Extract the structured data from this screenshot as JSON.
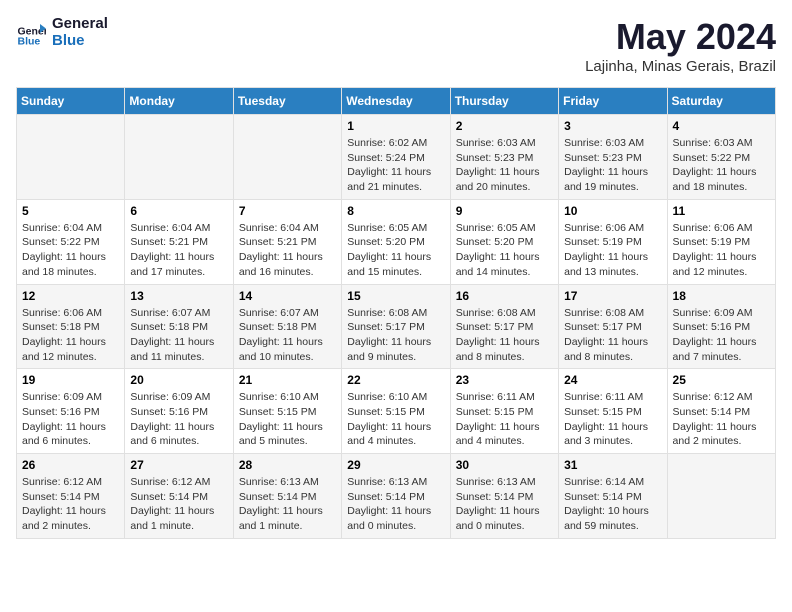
{
  "logo": {
    "line1": "General",
    "line2": "Blue"
  },
  "title": "May 2024",
  "location": "Lajinha, Minas Gerais, Brazil",
  "headers": [
    "Sunday",
    "Monday",
    "Tuesday",
    "Wednesday",
    "Thursday",
    "Friday",
    "Saturday"
  ],
  "weeks": [
    [
      {
        "day": "",
        "info": ""
      },
      {
        "day": "",
        "info": ""
      },
      {
        "day": "",
        "info": ""
      },
      {
        "day": "1",
        "info": "Sunrise: 6:02 AM\nSunset: 5:24 PM\nDaylight: 11 hours\nand 21 minutes."
      },
      {
        "day": "2",
        "info": "Sunrise: 6:03 AM\nSunset: 5:23 PM\nDaylight: 11 hours\nand 20 minutes."
      },
      {
        "day": "3",
        "info": "Sunrise: 6:03 AM\nSunset: 5:23 PM\nDaylight: 11 hours\nand 19 minutes."
      },
      {
        "day": "4",
        "info": "Sunrise: 6:03 AM\nSunset: 5:22 PM\nDaylight: 11 hours\nand 18 minutes."
      }
    ],
    [
      {
        "day": "5",
        "info": "Sunrise: 6:04 AM\nSunset: 5:22 PM\nDaylight: 11 hours\nand 18 minutes."
      },
      {
        "day": "6",
        "info": "Sunrise: 6:04 AM\nSunset: 5:21 PM\nDaylight: 11 hours\nand 17 minutes."
      },
      {
        "day": "7",
        "info": "Sunrise: 6:04 AM\nSunset: 5:21 PM\nDaylight: 11 hours\nand 16 minutes."
      },
      {
        "day": "8",
        "info": "Sunrise: 6:05 AM\nSunset: 5:20 PM\nDaylight: 11 hours\nand 15 minutes."
      },
      {
        "day": "9",
        "info": "Sunrise: 6:05 AM\nSunset: 5:20 PM\nDaylight: 11 hours\nand 14 minutes."
      },
      {
        "day": "10",
        "info": "Sunrise: 6:06 AM\nSunset: 5:19 PM\nDaylight: 11 hours\nand 13 minutes."
      },
      {
        "day": "11",
        "info": "Sunrise: 6:06 AM\nSunset: 5:19 PM\nDaylight: 11 hours\nand 12 minutes."
      }
    ],
    [
      {
        "day": "12",
        "info": "Sunrise: 6:06 AM\nSunset: 5:18 PM\nDaylight: 11 hours\nand 12 minutes."
      },
      {
        "day": "13",
        "info": "Sunrise: 6:07 AM\nSunset: 5:18 PM\nDaylight: 11 hours\nand 11 minutes."
      },
      {
        "day": "14",
        "info": "Sunrise: 6:07 AM\nSunset: 5:18 PM\nDaylight: 11 hours\nand 10 minutes."
      },
      {
        "day": "15",
        "info": "Sunrise: 6:08 AM\nSunset: 5:17 PM\nDaylight: 11 hours\nand 9 minutes."
      },
      {
        "day": "16",
        "info": "Sunrise: 6:08 AM\nSunset: 5:17 PM\nDaylight: 11 hours\nand 8 minutes."
      },
      {
        "day": "17",
        "info": "Sunrise: 6:08 AM\nSunset: 5:17 PM\nDaylight: 11 hours\nand 8 minutes."
      },
      {
        "day": "18",
        "info": "Sunrise: 6:09 AM\nSunset: 5:16 PM\nDaylight: 11 hours\nand 7 minutes."
      }
    ],
    [
      {
        "day": "19",
        "info": "Sunrise: 6:09 AM\nSunset: 5:16 PM\nDaylight: 11 hours\nand 6 minutes."
      },
      {
        "day": "20",
        "info": "Sunrise: 6:09 AM\nSunset: 5:16 PM\nDaylight: 11 hours\nand 6 minutes."
      },
      {
        "day": "21",
        "info": "Sunrise: 6:10 AM\nSunset: 5:15 PM\nDaylight: 11 hours\nand 5 minutes."
      },
      {
        "day": "22",
        "info": "Sunrise: 6:10 AM\nSunset: 5:15 PM\nDaylight: 11 hours\nand 4 minutes."
      },
      {
        "day": "23",
        "info": "Sunrise: 6:11 AM\nSunset: 5:15 PM\nDaylight: 11 hours\nand 4 minutes."
      },
      {
        "day": "24",
        "info": "Sunrise: 6:11 AM\nSunset: 5:15 PM\nDaylight: 11 hours\nand 3 minutes."
      },
      {
        "day": "25",
        "info": "Sunrise: 6:12 AM\nSunset: 5:14 PM\nDaylight: 11 hours\nand 2 minutes."
      }
    ],
    [
      {
        "day": "26",
        "info": "Sunrise: 6:12 AM\nSunset: 5:14 PM\nDaylight: 11 hours\nand 2 minutes."
      },
      {
        "day": "27",
        "info": "Sunrise: 6:12 AM\nSunset: 5:14 PM\nDaylight: 11 hours\nand 1 minute."
      },
      {
        "day": "28",
        "info": "Sunrise: 6:13 AM\nSunset: 5:14 PM\nDaylight: 11 hours\nand 1 minute."
      },
      {
        "day": "29",
        "info": "Sunrise: 6:13 AM\nSunset: 5:14 PM\nDaylight: 11 hours\nand 0 minutes."
      },
      {
        "day": "30",
        "info": "Sunrise: 6:13 AM\nSunset: 5:14 PM\nDaylight: 11 hours\nand 0 minutes."
      },
      {
        "day": "31",
        "info": "Sunrise: 6:14 AM\nSunset: 5:14 PM\nDaylight: 10 hours\nand 59 minutes."
      },
      {
        "day": "",
        "info": ""
      }
    ]
  ]
}
